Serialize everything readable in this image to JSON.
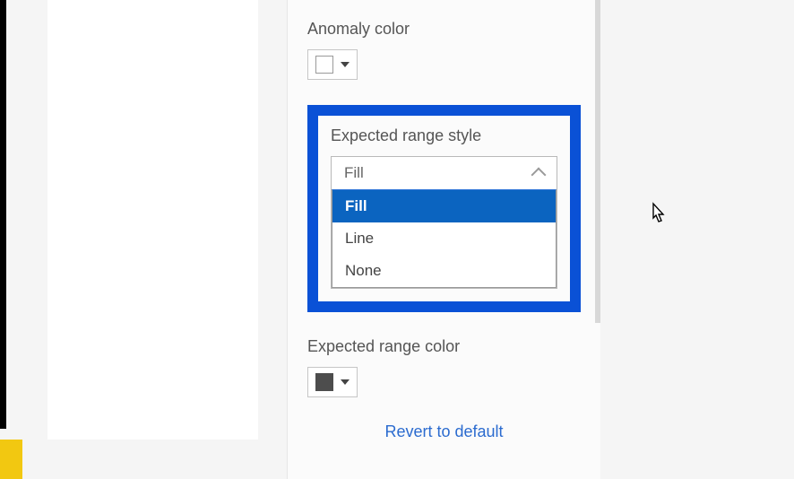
{
  "anomaly": {
    "label": "Anomaly color",
    "swatch_color": "#ffffff"
  },
  "range_style": {
    "label": "Expected range style",
    "current": "Fill",
    "options": [
      "Fill",
      "Line",
      "None"
    ]
  },
  "range_color": {
    "label": "Expected range color",
    "swatch_color": "#4d4d4d"
  },
  "revert_label": "Revert to default",
  "colors": {
    "highlight": "#0a51d6",
    "selected_bg": "#0b64c0",
    "link": "#2b6bcf"
  }
}
